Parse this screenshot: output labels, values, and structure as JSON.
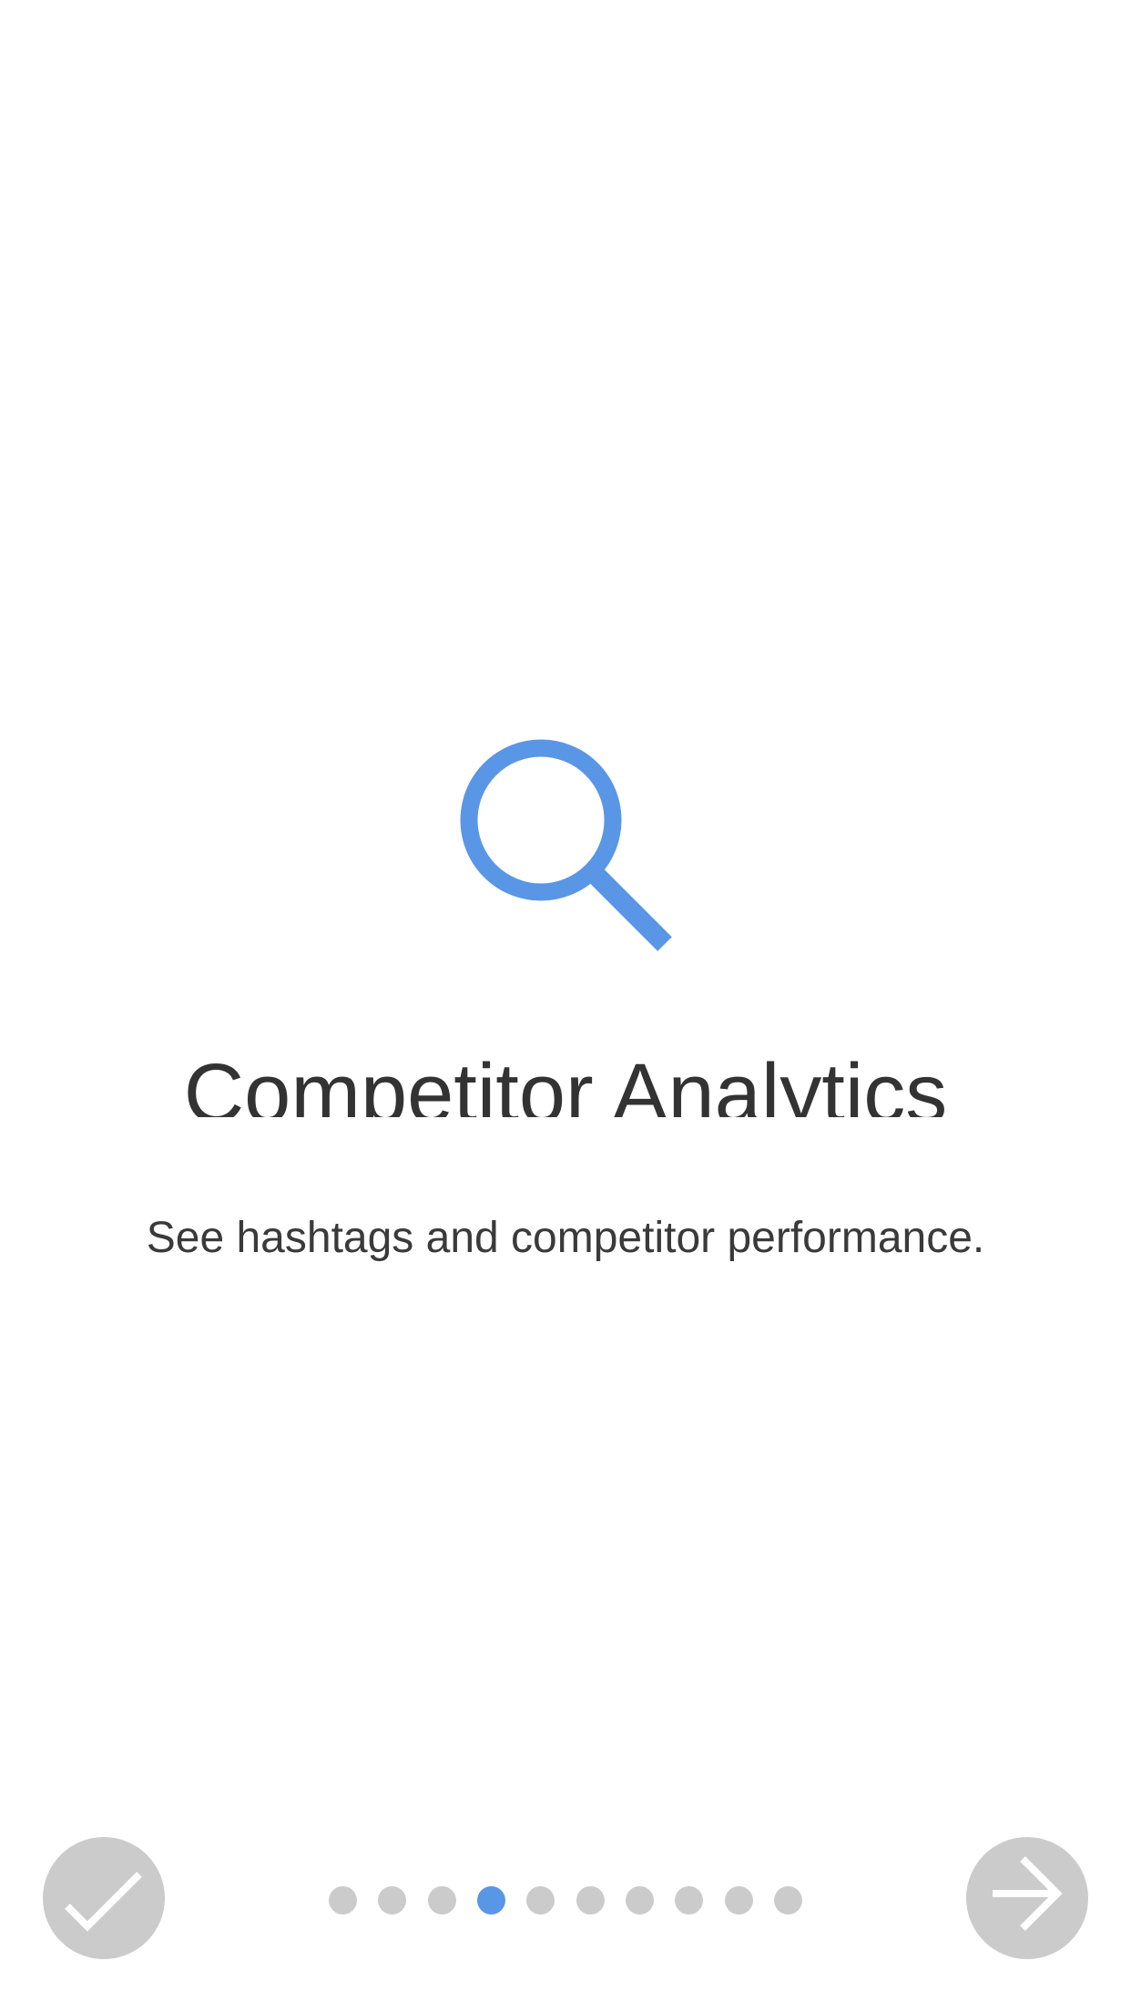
{
  "onboarding": {
    "title": "Competitor Analytics",
    "subtitle": "See hashtags and competitor performance.",
    "hero_icon": "magnifying-glass-icon",
    "accent_color": "#5a96e6",
    "inactive_color": "#cbcbcb"
  },
  "footer": {
    "done_button_icon": "checkmark-icon",
    "next_button_icon": "arrow-right-icon",
    "page_count": 10,
    "current_page": 4
  }
}
